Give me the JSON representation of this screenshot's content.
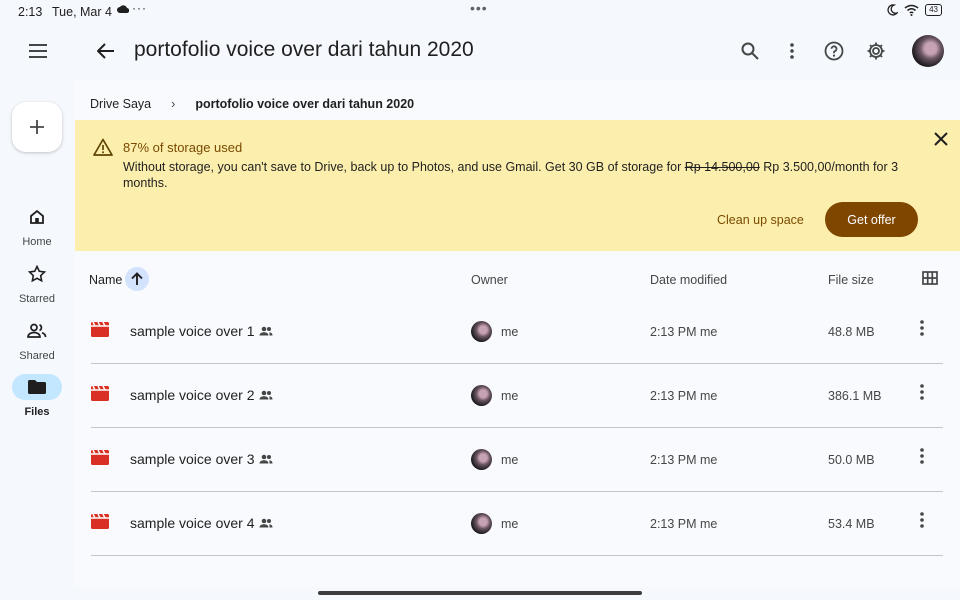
{
  "status_bar": {
    "time": "2:13",
    "date": "Tue, Mar 4",
    "more": "···",
    "center_dots": "•••",
    "battery": "43"
  },
  "top_bar": {
    "title": "portofolio voice over dari tahun 2020"
  },
  "nav_rail": {
    "items": [
      {
        "label": "Home",
        "icon": "home-icon"
      },
      {
        "label": "Starred",
        "icon": "star-icon"
      },
      {
        "label": "Shared",
        "icon": "people-icon"
      },
      {
        "label": "Files",
        "icon": "folder-icon",
        "active": true
      }
    ]
  },
  "breadcrumb": {
    "root": "Drive Saya",
    "separator": "›",
    "current": "portofolio voice over dari tahun 2020"
  },
  "banner": {
    "title": "87% of storage used",
    "message_before": "Without storage, you can't save to Drive, back up to Photos, and use Gmail. Get 30 GB of storage for ",
    "old_price": "Rp 14.500,00",
    "message_after": " Rp 3.500,00/month for 3 months.",
    "clean_up_label": "Clean up space",
    "get_offer_label": "Get offer",
    "accent_color": "#7f4600",
    "background_color": "#fcefae"
  },
  "list_header": {
    "name": "Name",
    "owner": "Owner",
    "date_modified": "Date modified",
    "file_size": "File size"
  },
  "files": [
    {
      "name": "sample voice over 1",
      "owner": "me",
      "date_modified": "2:13 PM me",
      "size": "48.8 MB"
    },
    {
      "name": "sample voice over 2",
      "owner": "me",
      "date_modified": "2:13 PM me",
      "size": "386.1 MB"
    },
    {
      "name": "sample voice over 3",
      "owner": "me",
      "date_modified": "2:13 PM me",
      "size": "50.0 MB"
    },
    {
      "name": "sample voice over 4",
      "owner": "me",
      "date_modified": "2:13 PM me",
      "size": "53.4 MB"
    }
  ],
  "colors": {
    "video_icon": "#d93025",
    "sort_chip": "#d3e3fd",
    "active_rail": "#c2e7ff"
  }
}
